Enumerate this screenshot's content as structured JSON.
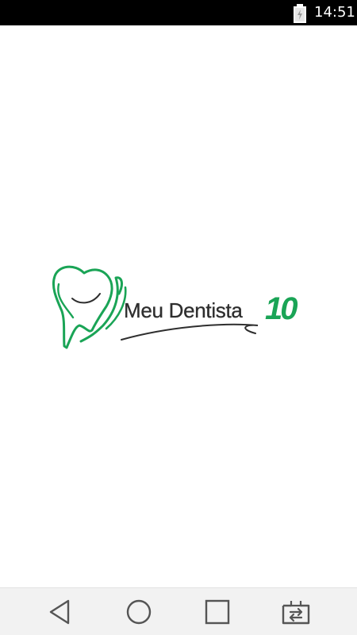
{
  "status_bar": {
    "time": "14:51",
    "battery_icon": "battery-charging-icon"
  },
  "logo": {
    "text": "Meu Dentista",
    "number": "10",
    "icon": "tooth-smile-icon",
    "colors": {
      "green": "#1aa456",
      "text": "#2e2e2e"
    }
  },
  "nav_bar": {
    "back_icon": "back-triangle-icon",
    "home_icon": "home-circle-icon",
    "recents_icon": "recents-square-icon",
    "switch_icon": "switch-apps-icon"
  }
}
